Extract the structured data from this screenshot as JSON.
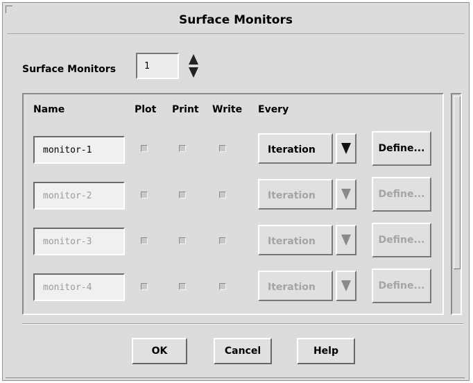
{
  "dialog": {
    "title": "Surface Monitors"
  },
  "count": {
    "label": "Surface Monitors",
    "value": "1"
  },
  "columns": {
    "name": "Name",
    "plot": "Plot",
    "print": "Print",
    "write": "Write",
    "every": "Every"
  },
  "monitors": [
    {
      "name": "monitor-1",
      "every": "Iteration",
      "define": "Define...",
      "enabled": true
    },
    {
      "name": "monitor-2",
      "every": "Iteration",
      "define": "Define...",
      "enabled": false
    },
    {
      "name": "monitor-3",
      "every": "Iteration",
      "define": "Define...",
      "enabled": false
    },
    {
      "name": "monitor-4",
      "every": "Iteration",
      "define": "Define...",
      "enabled": false
    }
  ],
  "buttons": {
    "ok": "OK",
    "cancel": "Cancel",
    "help": "Help"
  }
}
